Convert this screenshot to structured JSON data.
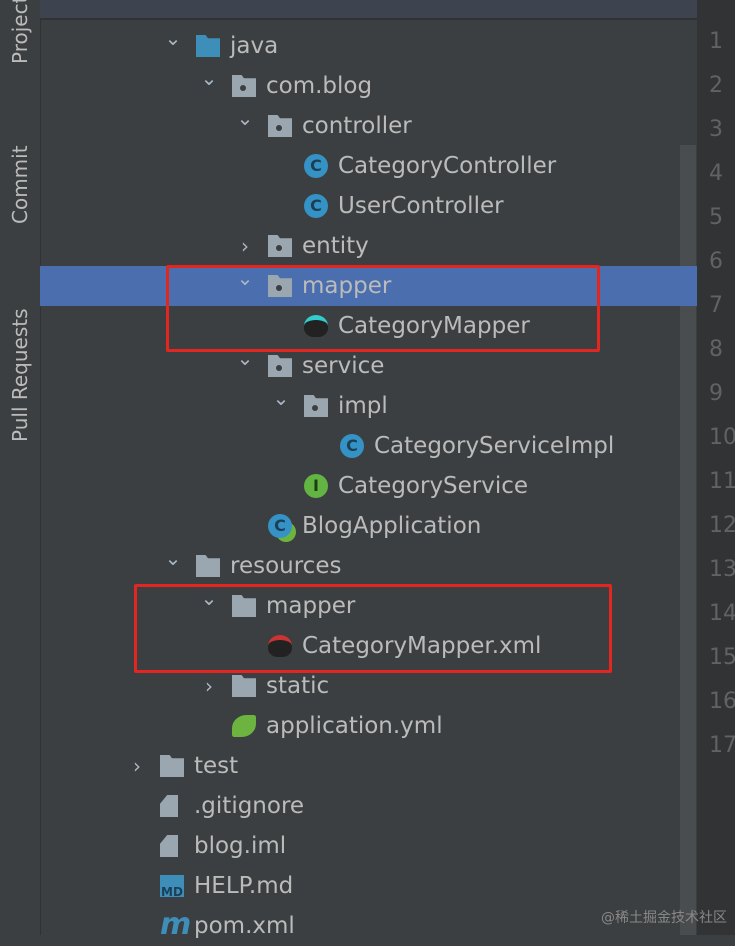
{
  "sidebar": {
    "tabs": [
      {
        "label": "Project"
      },
      {
        "label": "Commit"
      },
      {
        "label": "Pull Requests"
      }
    ]
  },
  "line_numbers": [
    "1",
    "2",
    "3",
    "4",
    "5",
    "6",
    "7",
    "8",
    "9",
    "10",
    "11",
    "12",
    "13",
    "14",
    "15",
    "16",
    "17"
  ],
  "tree": [
    {
      "label": "java",
      "level": 1,
      "chevron": "down",
      "icon": "source-folder"
    },
    {
      "label": "com.blog",
      "level": 2,
      "chevron": "down",
      "icon": "package"
    },
    {
      "label": "controller",
      "level": 3,
      "chevron": "down",
      "icon": "package"
    },
    {
      "label": "CategoryController",
      "level": 4,
      "icon": "class",
      "glyph": "C"
    },
    {
      "label": "UserController",
      "level": 4,
      "icon": "class",
      "glyph": "C"
    },
    {
      "label": "entity",
      "level": 3,
      "chevron": "right",
      "icon": "package"
    },
    {
      "label": "mapper",
      "level": 3,
      "chevron": "down",
      "icon": "package",
      "selected": true
    },
    {
      "label": "CategoryMapper",
      "level": 4,
      "icon": "mybatis-mapper"
    },
    {
      "label": "service",
      "level": 3,
      "chevron": "down",
      "icon": "package"
    },
    {
      "label": "impl",
      "level": 4,
      "chevron": "down",
      "icon": "package"
    },
    {
      "label": "CategoryServiceImpl",
      "level": 5,
      "icon": "class",
      "glyph": "C"
    },
    {
      "label": "CategoryService",
      "level": 4,
      "icon": "interface",
      "glyph": "I"
    },
    {
      "label": "BlogApplication",
      "level": 3,
      "icon": "spring-boot-app"
    },
    {
      "label": "resources",
      "level": 1,
      "chevron": "down",
      "icon": "resources-folder"
    },
    {
      "label": "mapper",
      "level": 2,
      "chevron": "down",
      "icon": "folder"
    },
    {
      "label": "CategoryMapper.xml",
      "level": 3,
      "icon": "mybatis-xml"
    },
    {
      "label": "static",
      "level": 2,
      "chevron": "right",
      "icon": "folder"
    },
    {
      "label": "application.yml",
      "level": 2,
      "icon": "yml"
    },
    {
      "label": "test",
      "level": 0,
      "chevron": "right",
      "icon": "folder"
    },
    {
      "label": ".gitignore",
      "level": 0,
      "icon": "gitignore-file"
    },
    {
      "label": "blog.iml",
      "level": 0,
      "icon": "iml-file"
    },
    {
      "label": "HELP.md",
      "level": 0,
      "icon": "markdown-file"
    },
    {
      "label": "pom.xml",
      "level": 0,
      "icon": "maven-file"
    }
  ],
  "watermark": "@稀土掘金技术社区",
  "colors": {
    "selection": "#4b6eaf",
    "highlight": "#e3261f"
  }
}
